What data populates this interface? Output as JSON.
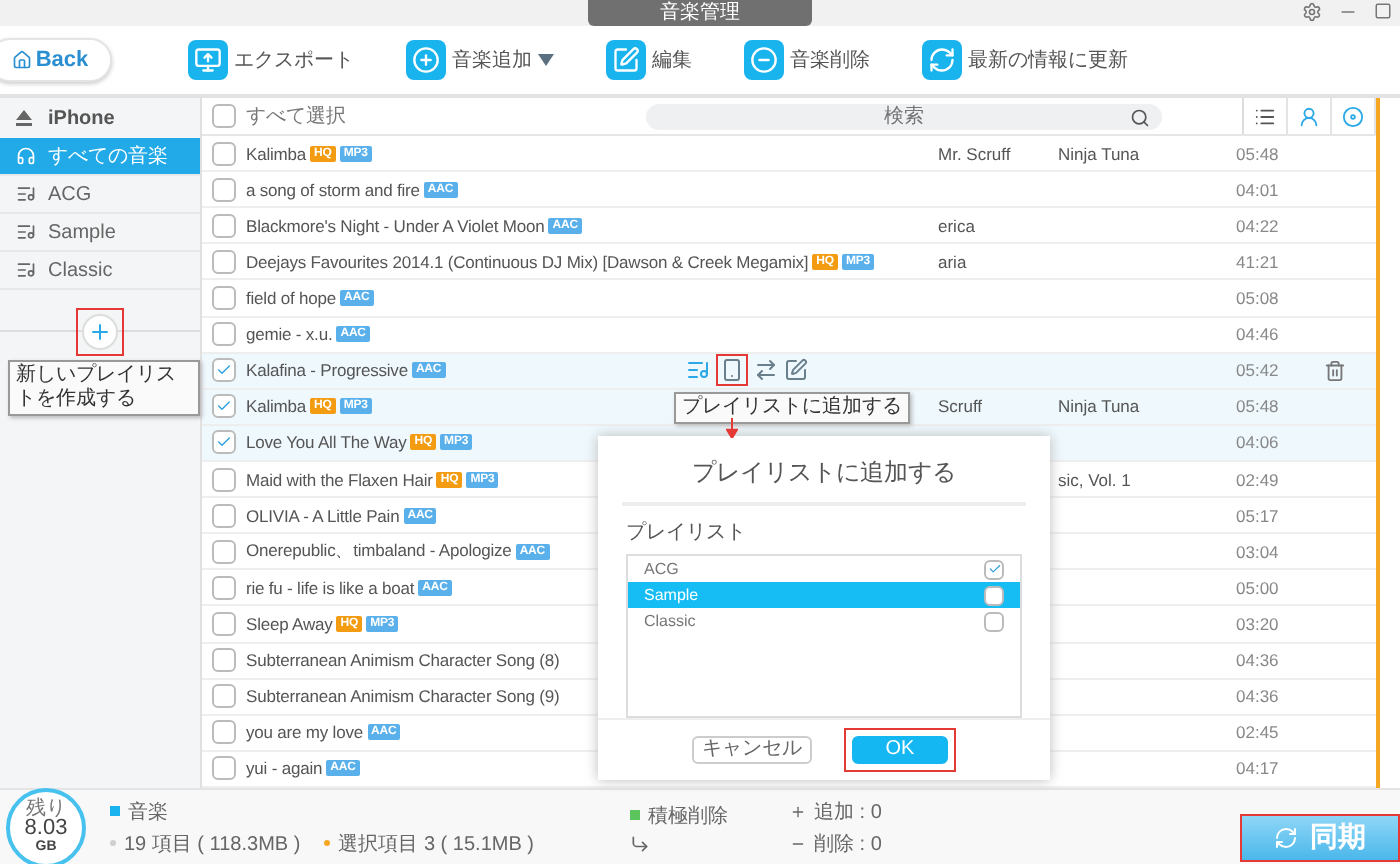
{
  "window": {
    "title": "音楽管理"
  },
  "back_button": {
    "label": "Back"
  },
  "toolbar": [
    {
      "label": "エクスポート",
      "kind": "export",
      "dropdown": false
    },
    {
      "label": "音楽追加",
      "kind": "add",
      "dropdown": true
    },
    {
      "label": "編集",
      "kind": "edit",
      "dropdown": false
    },
    {
      "label": "音楽削除",
      "kind": "delete",
      "dropdown": false
    },
    {
      "label": "最新の情報に更新",
      "kind": "refresh",
      "dropdown": false
    }
  ],
  "sidebar": {
    "device": "iPhone",
    "items": [
      {
        "label": "すべての音楽",
        "kind": "all",
        "selected": true
      },
      {
        "label": "ACG",
        "kind": "playlist",
        "selected": false
      },
      {
        "label": "Sample",
        "kind": "playlist",
        "selected": false
      },
      {
        "label": "Classic",
        "kind": "playlist",
        "selected": false
      }
    ],
    "add_tooltip": "新しいプレイリストを作成する"
  },
  "list": {
    "select_all": {
      "label": "すべて選択",
      "checked": false
    },
    "search": {
      "placeholder": "検索"
    },
    "rows": [
      {
        "title": "Kalimba",
        "tags": [
          {
            "text": "HQ",
            "kind": "quality"
          },
          {
            "text": "MP3",
            "kind": "format"
          }
        ],
        "artist": "Mr. Scruff",
        "album": "Ninja Tuna",
        "duration": "05:48",
        "checked": false,
        "hovered": false
      },
      {
        "title": "a song of storm and fire",
        "tags": [
          {
            "text": "AAC",
            "kind": "format"
          }
        ],
        "duration": "04:01",
        "checked": false,
        "hovered": false
      },
      {
        "title": "Blackmore's Night - Under A Violet Moon",
        "tags": [
          {
            "text": "AAC",
            "kind": "format"
          }
        ],
        "artist": "erica",
        "duration": "04:22",
        "checked": false,
        "hovered": false
      },
      {
        "title": "Deejays Favourites 2014.1 (Continuous DJ Mix) [Dawson & Creek Megamix]",
        "tags": [
          {
            "text": "HQ",
            "kind": "quality"
          },
          {
            "text": "MP3",
            "kind": "format"
          }
        ],
        "artist": "aria",
        "duration": "41:21",
        "checked": false,
        "hovered": false
      },
      {
        "title": "field of hope",
        "tags": [
          {
            "text": "AAC",
            "kind": "format"
          }
        ],
        "duration": "05:08",
        "checked": false,
        "hovered": false
      },
      {
        "title": "gemie - x.u.",
        "tags": [
          {
            "text": "AAC",
            "kind": "format"
          }
        ],
        "duration": "04:46",
        "checked": false,
        "hovered": false
      },
      {
        "title": "Kalafina - Progressive",
        "tags": [
          {
            "text": "AAC",
            "kind": "format"
          }
        ],
        "duration": "05:42",
        "checked": true,
        "hovered": true
      },
      {
        "title": "Kalimba",
        "tags": [
          {
            "text": "HQ",
            "kind": "quality"
          },
          {
            "text": "MP3",
            "kind": "format"
          }
        ],
        "artist": "Scruff",
        "album": "Ninja Tuna",
        "duration": "05:48",
        "checked": true,
        "hovered": false
      },
      {
        "title": "Love You All The Way",
        "tags": [
          {
            "text": "HQ",
            "kind": "quality"
          },
          {
            "text": "MP3",
            "kind": "format"
          }
        ],
        "duration": "04:06",
        "checked": true,
        "hovered": false
      },
      {
        "title": "Maid with the Flaxen Hair",
        "tags": [
          {
            "text": "HQ",
            "kind": "quality"
          },
          {
            "text": "MP3",
            "kind": "format"
          }
        ],
        "album": "sic, Vol. 1",
        "duration": "02:49",
        "checked": false,
        "hovered": false
      },
      {
        "title": "OLIVIA - A Little Pain",
        "tags": [
          {
            "text": "AAC",
            "kind": "format"
          }
        ],
        "duration": "05:17",
        "checked": false,
        "hovered": false
      },
      {
        "title": "Onerepublic、timbaland - Apologize",
        "tags": [
          {
            "text": "AAC",
            "kind": "format"
          }
        ],
        "duration": "03:04",
        "checked": false,
        "hovered": false
      },
      {
        "title": "rie fu - life is like a boat",
        "tags": [
          {
            "text": "AAC",
            "kind": "format"
          }
        ],
        "duration": "05:00",
        "checked": false,
        "hovered": false
      },
      {
        "title": "Sleep Away",
        "tags": [
          {
            "text": "HQ",
            "kind": "quality"
          },
          {
            "text": "MP3",
            "kind": "format"
          }
        ],
        "duration": "03:20",
        "checked": false,
        "hovered": false
      },
      {
        "title": "Subterranean Animism Character Song (8)",
        "tags": [],
        "duration": "04:36",
        "checked": false,
        "hovered": false
      },
      {
        "title": "Subterranean Animism Character Song (9)",
        "tags": [],
        "duration": "04:36",
        "checked": false,
        "hovered": false
      },
      {
        "title": "you are my love",
        "tags": [
          {
            "text": "AAC",
            "kind": "format"
          }
        ],
        "duration": "02:45",
        "checked": false,
        "hovered": false
      },
      {
        "title": "yui - again",
        "tags": [
          {
            "text": "AAC",
            "kind": "format"
          }
        ],
        "duration": "04:17",
        "checked": false,
        "hovered": false
      }
    ],
    "action_tooltip": "プレイリストに追加する"
  },
  "dialog": {
    "title": "プレイリストに追加する",
    "section": "プレイリスト",
    "items": [
      {
        "label": "ACG",
        "checked": true,
        "selected": false
      },
      {
        "label": "Sample",
        "checked": false,
        "selected": true
      },
      {
        "label": "Classic",
        "checked": false,
        "selected": false
      }
    ],
    "buttons": [
      {
        "label": "キャンセル",
        "kind": "secondary"
      },
      {
        "label": "OK",
        "kind": "primary"
      }
    ]
  },
  "footer": {
    "storage": {
      "caption": "残り",
      "value": "8.03",
      "unit": "GB"
    },
    "legend": "音楽",
    "total": "19 項目 ( 118.3MB )",
    "selected": "選択項目 3 ( 15.1MB )",
    "cleanup": "積極削除",
    "added": "追加 : 0",
    "removed": "削除 : 0",
    "sync_button": "同期"
  }
}
